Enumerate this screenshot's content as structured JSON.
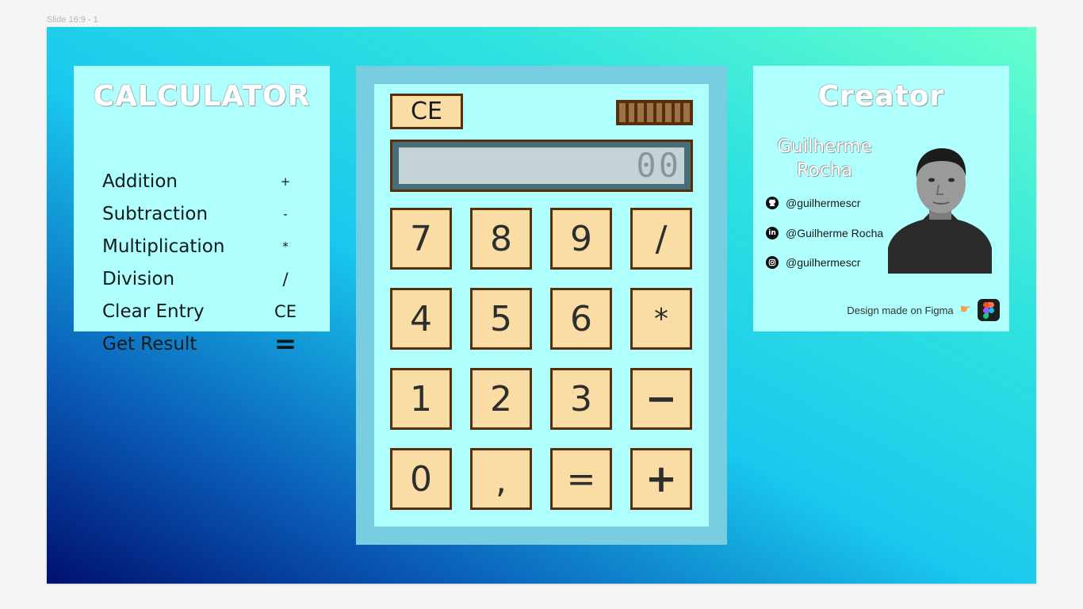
{
  "frame": {
    "label": "Slide 16:9 - 1"
  },
  "legend": {
    "title": "CALCULATOR",
    "rows": [
      {
        "label": "Addition",
        "symbol": "+"
      },
      {
        "label": "Subtraction",
        "symbol": "-"
      },
      {
        "label": "Multiplication",
        "symbol": "*"
      },
      {
        "label": "Division",
        "symbol": "/"
      },
      {
        "label": "Clear Entry",
        "symbol": "CE"
      },
      {
        "label": "Get Result",
        "symbol": "="
      }
    ]
  },
  "calculator": {
    "clear_label": "CE",
    "display_value": "00",
    "keys": [
      "7",
      "8",
      "9",
      "/",
      "4",
      "5",
      "6",
      "*",
      "1",
      "2",
      "3",
      "−",
      "0",
      ",",
      "=",
      "+"
    ]
  },
  "creator": {
    "title": "Creator",
    "name_line1": "Guilherme",
    "name_line2": "Rocha",
    "socials": [
      {
        "icon": "github-icon",
        "handle": "@guilhermescr"
      },
      {
        "icon": "linkedin-icon",
        "handle": "@Guilherme Rocha"
      },
      {
        "icon": "instagram-icon",
        "handle": "@guilhermescr"
      }
    ],
    "credit": "Design made on Figma"
  },
  "colors": {
    "key_face": "#fadda4",
    "key_border": "#5a2d0c",
    "panel": "#b0ffff",
    "calc_body": "#79cde0"
  }
}
